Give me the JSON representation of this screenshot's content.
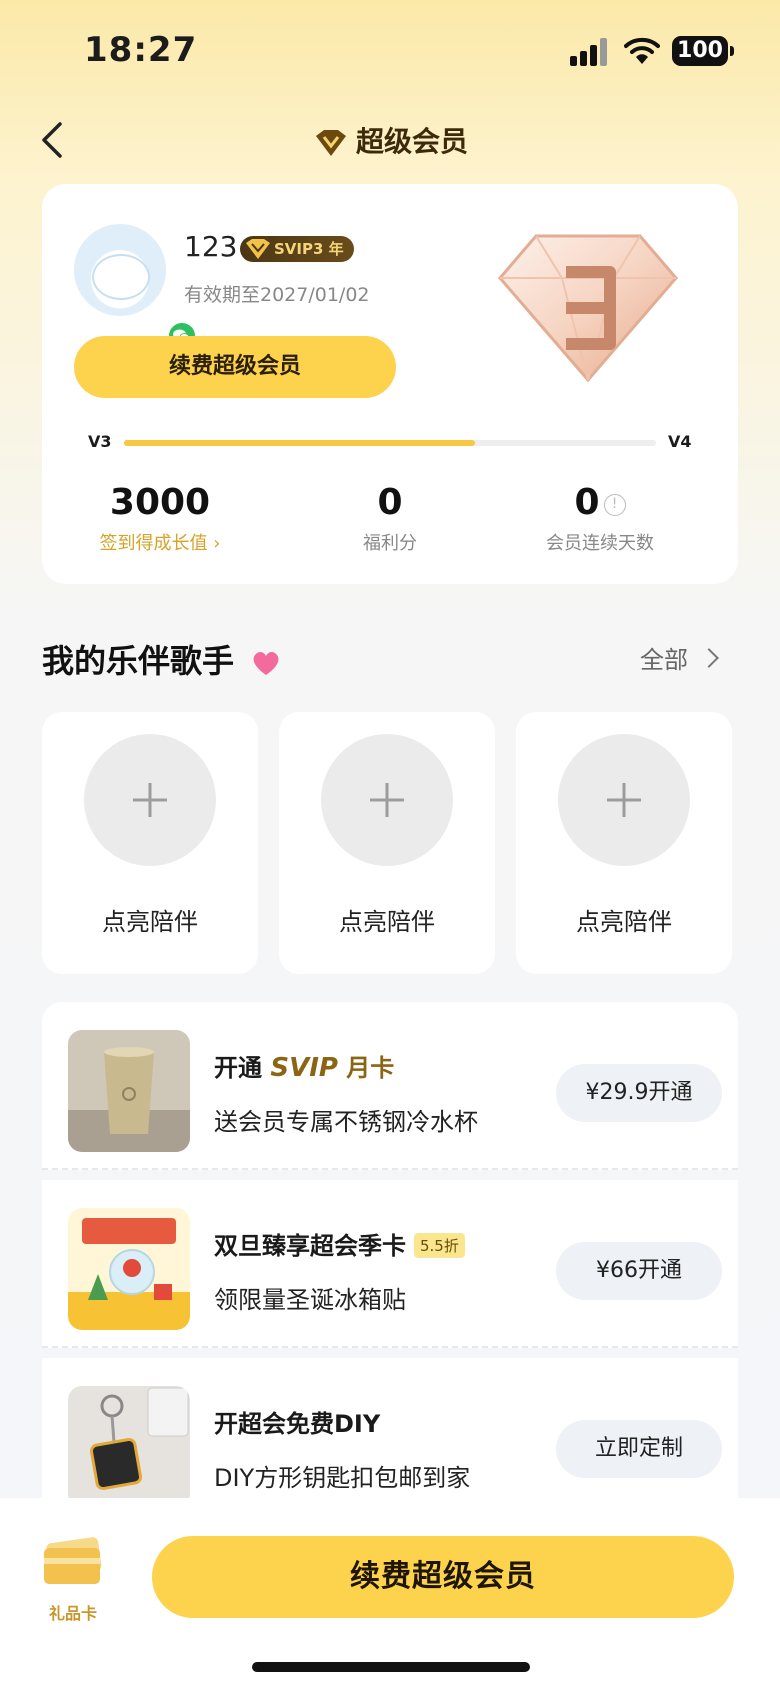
{
  "status_bar": {
    "time": "18:27",
    "battery": "100"
  },
  "nav": {
    "title": "超级会员"
  },
  "member": {
    "username": "123",
    "svip_badge": "SVIP3 年",
    "expire": "有效期至2027/01/02",
    "renew_label": "续费超级会员",
    "level_current": "V3",
    "level_next": "V4",
    "progress": 0.66,
    "stats": [
      {
        "value": "3000",
        "label": "签到得成长值 ›"
      },
      {
        "value": "0",
        "label": "福利分"
      },
      {
        "value": "0",
        "label": "会员连续天数"
      }
    ]
  },
  "companions": {
    "title": "我的乐伴歌手",
    "all_label": "全部",
    "cards": [
      {
        "label": "点亮陪伴"
      },
      {
        "label": "点亮陪伴"
      },
      {
        "label": "点亮陪伴"
      }
    ]
  },
  "offers": [
    {
      "title_prefix": "开通 ",
      "title_svip": "SVIP",
      "title_suffix": " 月卡",
      "subtitle": "送会员专属不锈钢冷水杯",
      "button": "¥29.9开通"
    },
    {
      "title": "双旦臻享超会季卡",
      "discount": "5.5折",
      "subtitle": "领限量圣诞冰箱贴",
      "button": "¥66开通"
    },
    {
      "title": "开超会免费DIY",
      "subtitle": "DIY方形钥匙扣包邮到家",
      "button": "立即定制"
    }
  ],
  "bottom": {
    "gift_label": "礼品卡",
    "renew_label": "续费超级会员"
  }
}
